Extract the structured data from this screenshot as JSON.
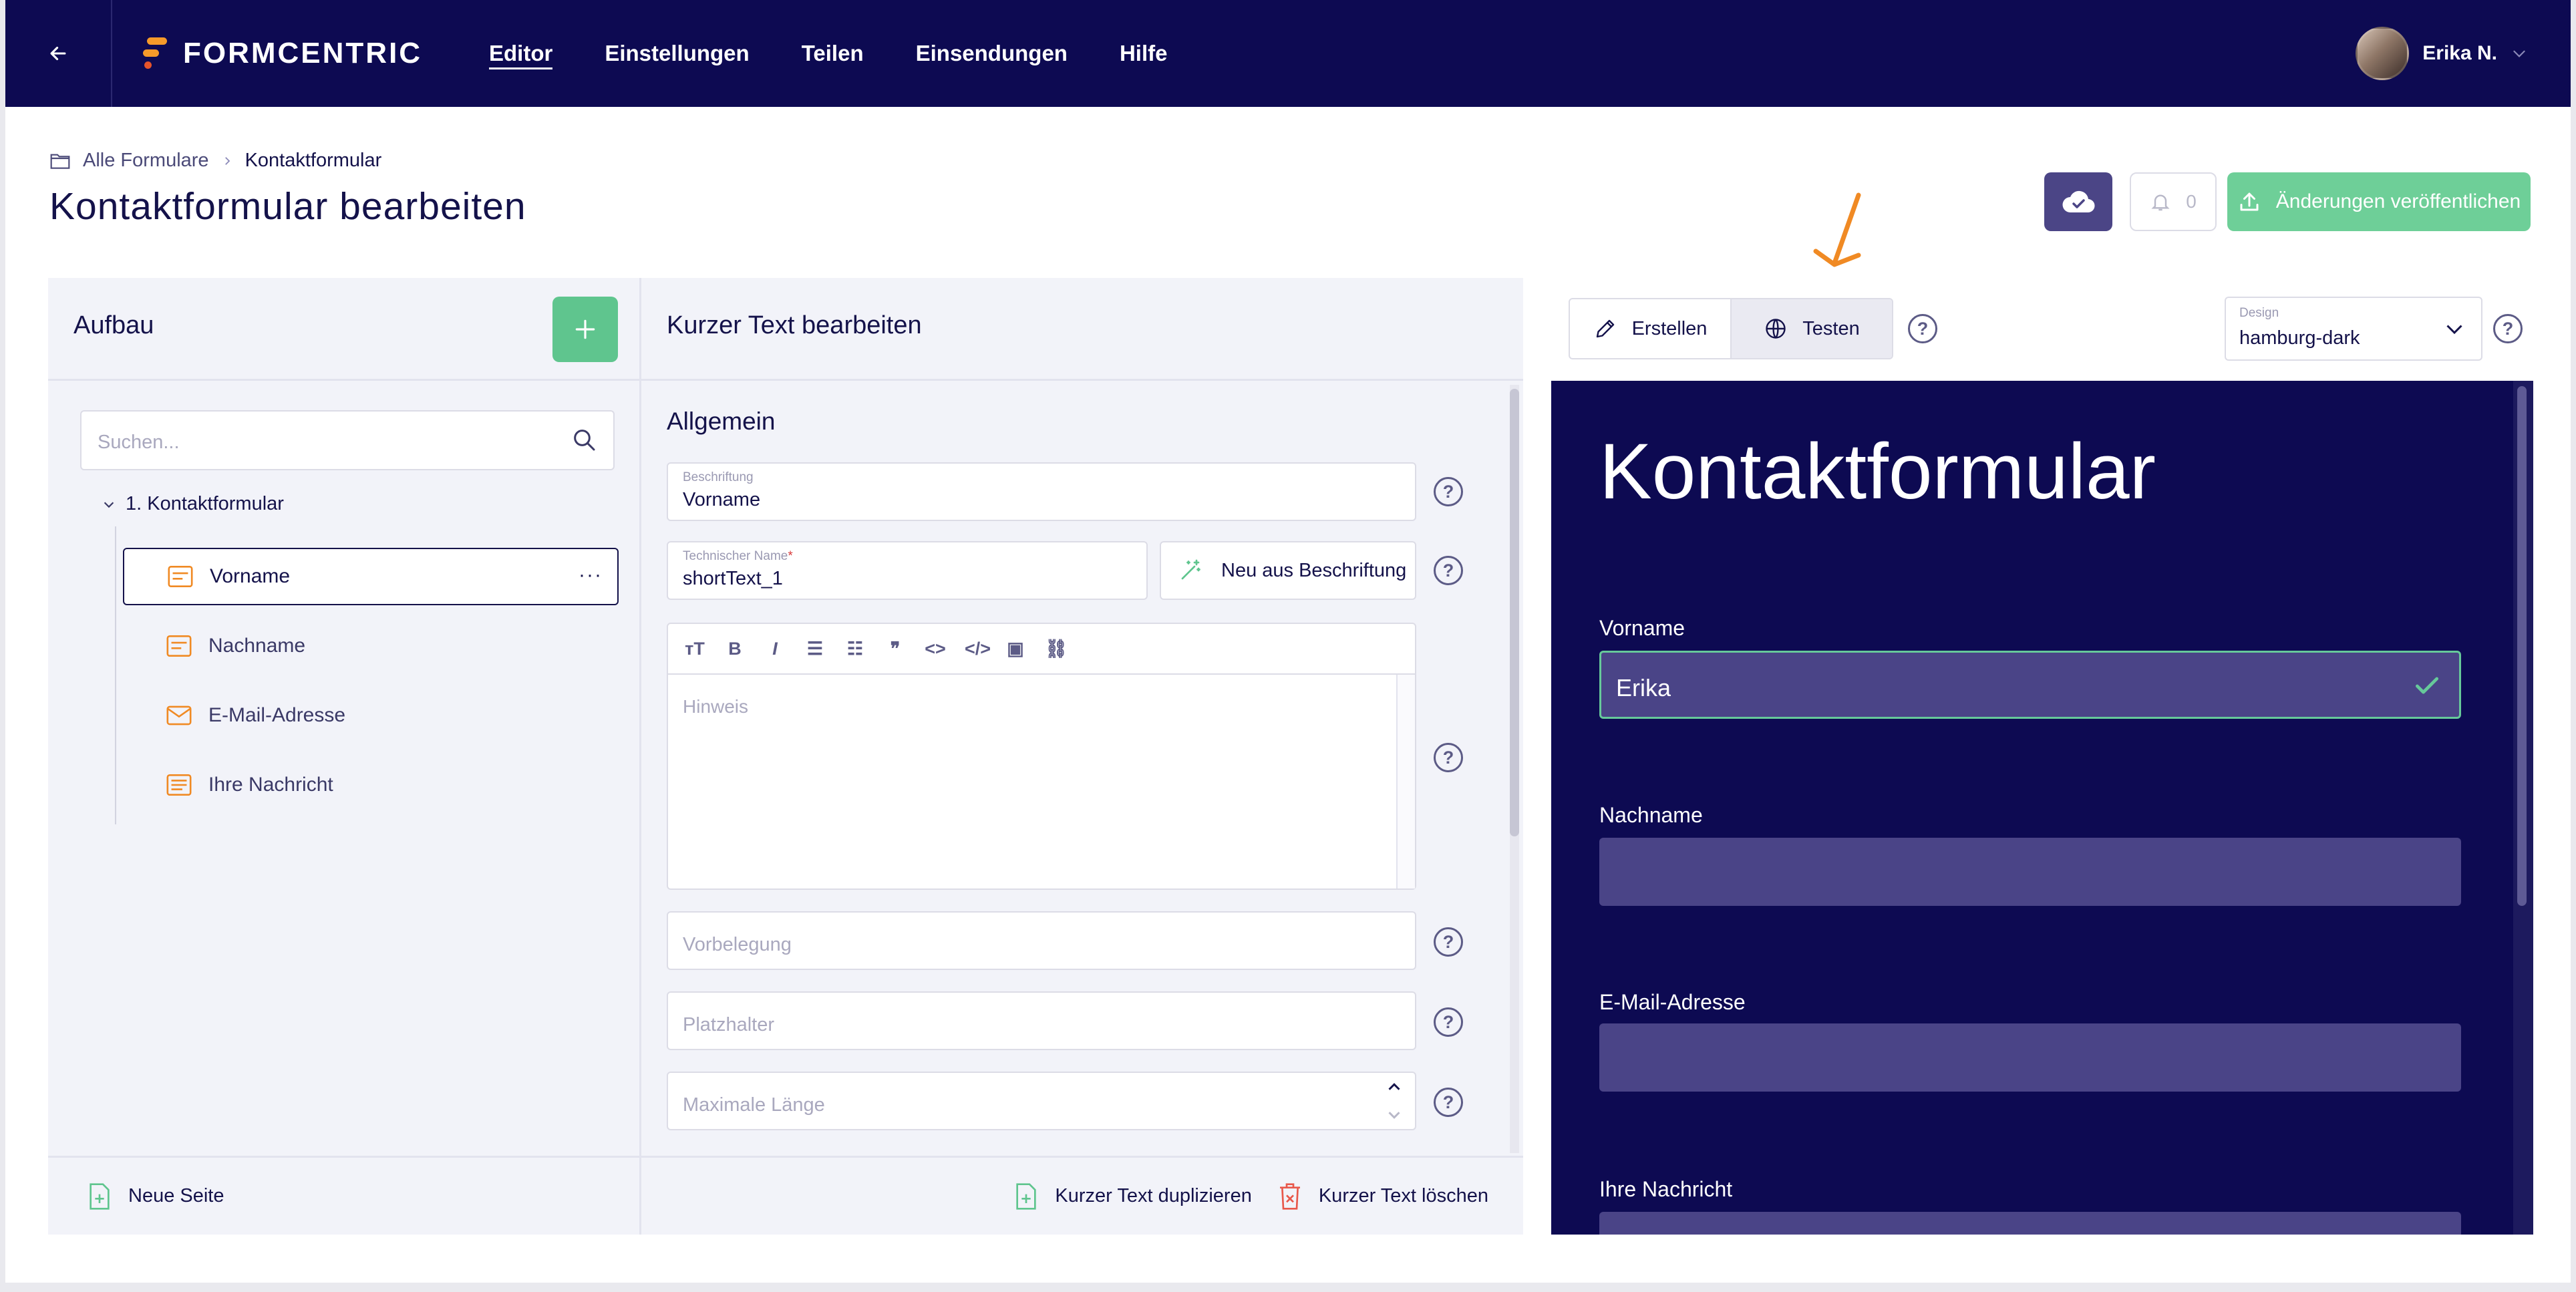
{
  "nav": {
    "logo": "FORMCENTRIC",
    "items": [
      {
        "label": "Editor",
        "active": true
      },
      {
        "label": "Einstellungen",
        "active": false
      },
      {
        "label": "Teilen",
        "active": false
      },
      {
        "label": "Einsendungen",
        "active": false
      },
      {
        "label": "Hilfe",
        "active": false
      }
    ],
    "user": "Erika N."
  },
  "breadcrumb": {
    "parent": "Alle Formulare",
    "current": "Kontaktformular"
  },
  "page_title": "Kontaktformular bearbeiten",
  "actions": {
    "notification_count": "0",
    "publish_label": "Änderungen veröffentlichen"
  },
  "left_panel": {
    "title": "Aufbau",
    "search_placeholder": "Suchen...",
    "root": "1. Kontaktformular",
    "items": [
      {
        "label": "Vorname",
        "icon": "short-text-icon"
      },
      {
        "label": "Nachname",
        "icon": "short-text-icon"
      },
      {
        "label": "E-Mail-Adresse",
        "icon": "email-icon"
      },
      {
        "label": "Ihre Nachricht",
        "icon": "long-text-icon"
      }
    ],
    "footer_action": "Neue Seite"
  },
  "mid_panel": {
    "title": "Kurzer Text bearbeiten",
    "section": "Allgemein",
    "caption_label": "Beschriftung",
    "caption_value": "Vorname",
    "technical_label": "Technischer Name",
    "technical_required": "*",
    "technical_value": "shortText_1",
    "generate_button": "Neu aus Beschriftung",
    "hint_placeholder": "Hinweis",
    "default_placeholder": "Vorbelegung",
    "placeholder_placeholder": "Platzhalter",
    "maxlength_placeholder": "Maximale Länge",
    "footer_duplicate": "Kurzer Text duplizieren",
    "footer_delete": "Kurzer Text löschen"
  },
  "right_panel": {
    "tab_create": "Erstellen",
    "tab_test": "Testen",
    "active_tab": "Testen",
    "design_label": "Design",
    "design_value": "hamburg-dark",
    "preview": {
      "title": "Kontaktformular",
      "fields": [
        {
          "label": "Vorname",
          "value": "Erika",
          "valid": true
        },
        {
          "label": "Nachname",
          "value": ""
        },
        {
          "label": "E-Mail-Adresse",
          "value": ""
        },
        {
          "label": "Ihre Nachricht",
          "value": ""
        }
      ]
    }
  },
  "colors": {
    "nav_bg": "#0d0a52",
    "accent_green": "#5fc58e",
    "preview_input": "#4a4487",
    "arrow": "#f08a24",
    "icon_orange": "#f08a24"
  }
}
